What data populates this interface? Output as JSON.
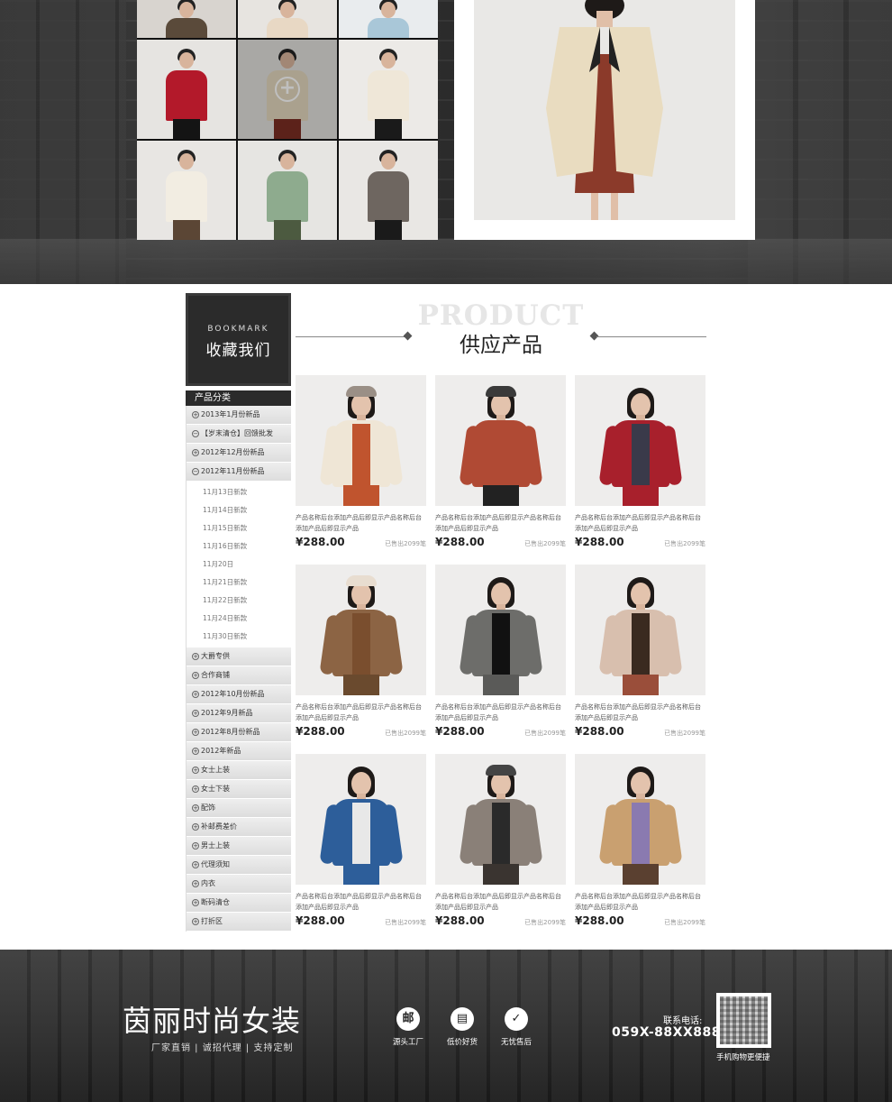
{
  "hero": {
    "thumbnails": [
      {
        "name": "thumb-1",
        "bg": "#d8d4cf",
        "coat": "#5a4a3a",
        "legs": "#222"
      },
      {
        "name": "thumb-2",
        "bg": "#e7e4e0",
        "coat": "#e8d8c4",
        "legs": "#2a2a2a"
      },
      {
        "name": "thumb-3",
        "bg": "#e9ecee",
        "coat": "#a9c7d8",
        "legs": "#2a2a2a"
      },
      {
        "name": "thumb-4",
        "bg": "#e6e4e1",
        "coat": "#b3192a",
        "legs": "#141414"
      },
      {
        "name": "thumb-5",
        "bg": "#e1e0dc",
        "coat": "#e2d6bd",
        "legs": "#7a2e22"
      },
      {
        "name": "thumb-6",
        "bg": "#eceae7",
        "coat": "#efe7d8",
        "legs": "#1a1a1a"
      },
      {
        "name": "thumb-7",
        "bg": "#e8e6e3",
        "coat": "#f2ede2",
        "legs": "#5b4635"
      },
      {
        "name": "thumb-8",
        "bg": "#e6e5e2",
        "coat": "#8eab8e",
        "legs": "#4c5a40"
      },
      {
        "name": "thumb-9",
        "bg": "#e9e7e4",
        "coat": "#6e6660",
        "legs": "#1a1a1a"
      }
    ],
    "featured_coat": "#e9dcc0",
    "featured_dress": "#8b3a2a"
  },
  "sidebar": {
    "bookmark_en": "BOOKMARK",
    "bookmark_cn": "收藏我们",
    "category_title": "产品分类",
    "categories_top": [
      {
        "sign": "+",
        "label": "2013年1月份新品"
      },
      {
        "sign": "−",
        "label": "【岁末清仓】回馈批发"
      },
      {
        "sign": "+",
        "label": "2012年12月份新品"
      },
      {
        "sign": "−",
        "label": "2012年11月份新品"
      }
    ],
    "subitems": [
      "11月13日新款",
      "11月14日新款",
      "11月15日新款",
      "11月16日新款",
      "11月20日",
      "11月21日新款",
      "11月22日新款",
      "11月24日新款",
      "11月30日新款"
    ],
    "categories_bottom": [
      {
        "sign": "+",
        "label": "大爵专供"
      },
      {
        "sign": "+",
        "label": "合作商铺"
      },
      {
        "sign": "+",
        "label": "2012年10月份新品"
      },
      {
        "sign": "+",
        "label": "2012年9月新品"
      },
      {
        "sign": "+",
        "label": "2012年8月份新品"
      },
      {
        "sign": "+",
        "label": "2012年新品"
      },
      {
        "sign": "+",
        "label": "女士上装"
      },
      {
        "sign": "+",
        "label": "女士下装"
      },
      {
        "sign": "+",
        "label": "配饰"
      },
      {
        "sign": "+",
        "label": "补邮费差价"
      },
      {
        "sign": "+",
        "label": "男士上装"
      },
      {
        "sign": "+",
        "label": "代理须知"
      },
      {
        "sign": "+",
        "label": "内衣"
      },
      {
        "sign": "+",
        "label": "断码清仓"
      },
      {
        "sign": "+",
        "label": "打折区"
      }
    ]
  },
  "products_section": {
    "title_en": "PRODUCT",
    "title_cn": "供应产品"
  },
  "products": [
    {
      "desc": "产品名称后台添加产品后即显示产品名称后台添加产品后即显示产品",
      "price": "¥288.00",
      "sold": "已售出2099笔",
      "top": "#efe6d6",
      "inner": "#c0542e",
      "hat": "#9a8f86",
      "bottom": "#c0542e"
    },
    {
      "desc": "产品名称后台添加产品后即显示产品名称后台添加产品后即显示产品",
      "price": "¥288.00",
      "sold": "已售出2099笔",
      "top": "#b04a34",
      "inner": "#b04a34",
      "hat": "#3a3a3a",
      "bottom": "#222"
    },
    {
      "desc": "产品名称后台添加产品后即显示产品名称后台添加产品后即显示产品",
      "price": "¥288.00",
      "sold": "已售出2099笔",
      "top": "#a8202c",
      "inner": "#3a3a4a",
      "hat": "",
      "bottom": "#a8202c"
    },
    {
      "desc": "产品名称后台添加产品后即显示产品名称后台添加产品后即显示产品",
      "price": "¥288.00",
      "sold": "已售出2099笔",
      "top": "#8c6444",
      "inner": "#7a4e2e",
      "hat": "#e8ddd0",
      "bottom": "#6a4a2e"
    },
    {
      "desc": "产品名称后台添加产品后即显示产品名称后台添加产品后即显示产品",
      "price": "¥288.00",
      "sold": "已售出2099笔",
      "top": "#6d6d6a",
      "inner": "#111",
      "hat": "",
      "bottom": "#5a5a58"
    },
    {
      "desc": "产品名称后台添加产品后即显示产品名称后台添加产品后即显示产品",
      "price": "¥288.00",
      "sold": "已售出2099笔",
      "top": "#d8bfae",
      "inner": "#3a2a20",
      "hat": "",
      "bottom": "#9a4e3a"
    },
    {
      "desc": "产品名称后台添加产品后即显示产品名称后台添加产品后即显示产品",
      "price": "¥288.00",
      "sold": "已售出2099笔",
      "top": "#2d5e9a",
      "inner": "#e8e8e8",
      "hat": "",
      "bottom": "#2d5e9a"
    },
    {
      "desc": "产品名称后台添加产品后即显示产品名称后台添加产品后即显示产品",
      "price": "¥288.00",
      "sold": "已售出2099笔",
      "top": "#8a8078",
      "inner": "#2a2a2a",
      "hat": "#444",
      "bottom": "#3a3430"
    },
    {
      "desc": "产品名称后台添加产品后即显示产品名称后台添加产品后即显示产品",
      "price": "¥288.00",
      "sold": "已售出2099笔",
      "top": "#c9a070",
      "inner": "#8a7ab0",
      "hat": "",
      "bottom": "#5a4030"
    }
  ],
  "footer": {
    "brand": "茵丽时尚女装",
    "slogan": "厂家直销 | 诚招代理 | 支持定制",
    "features": [
      {
        "icon": "邮",
        "icon_name": "mail-icon",
        "label": "源头工厂"
      },
      {
        "icon": "▤",
        "icon_name": "bag-icon",
        "label": "低价好货"
      },
      {
        "icon": "✓",
        "icon_name": "shield-check-icon",
        "label": "无忧售后"
      }
    ],
    "tel_label": "联系电话:",
    "tel": "059X-88XX8888",
    "qr_label": "手机购物更便捷"
  }
}
